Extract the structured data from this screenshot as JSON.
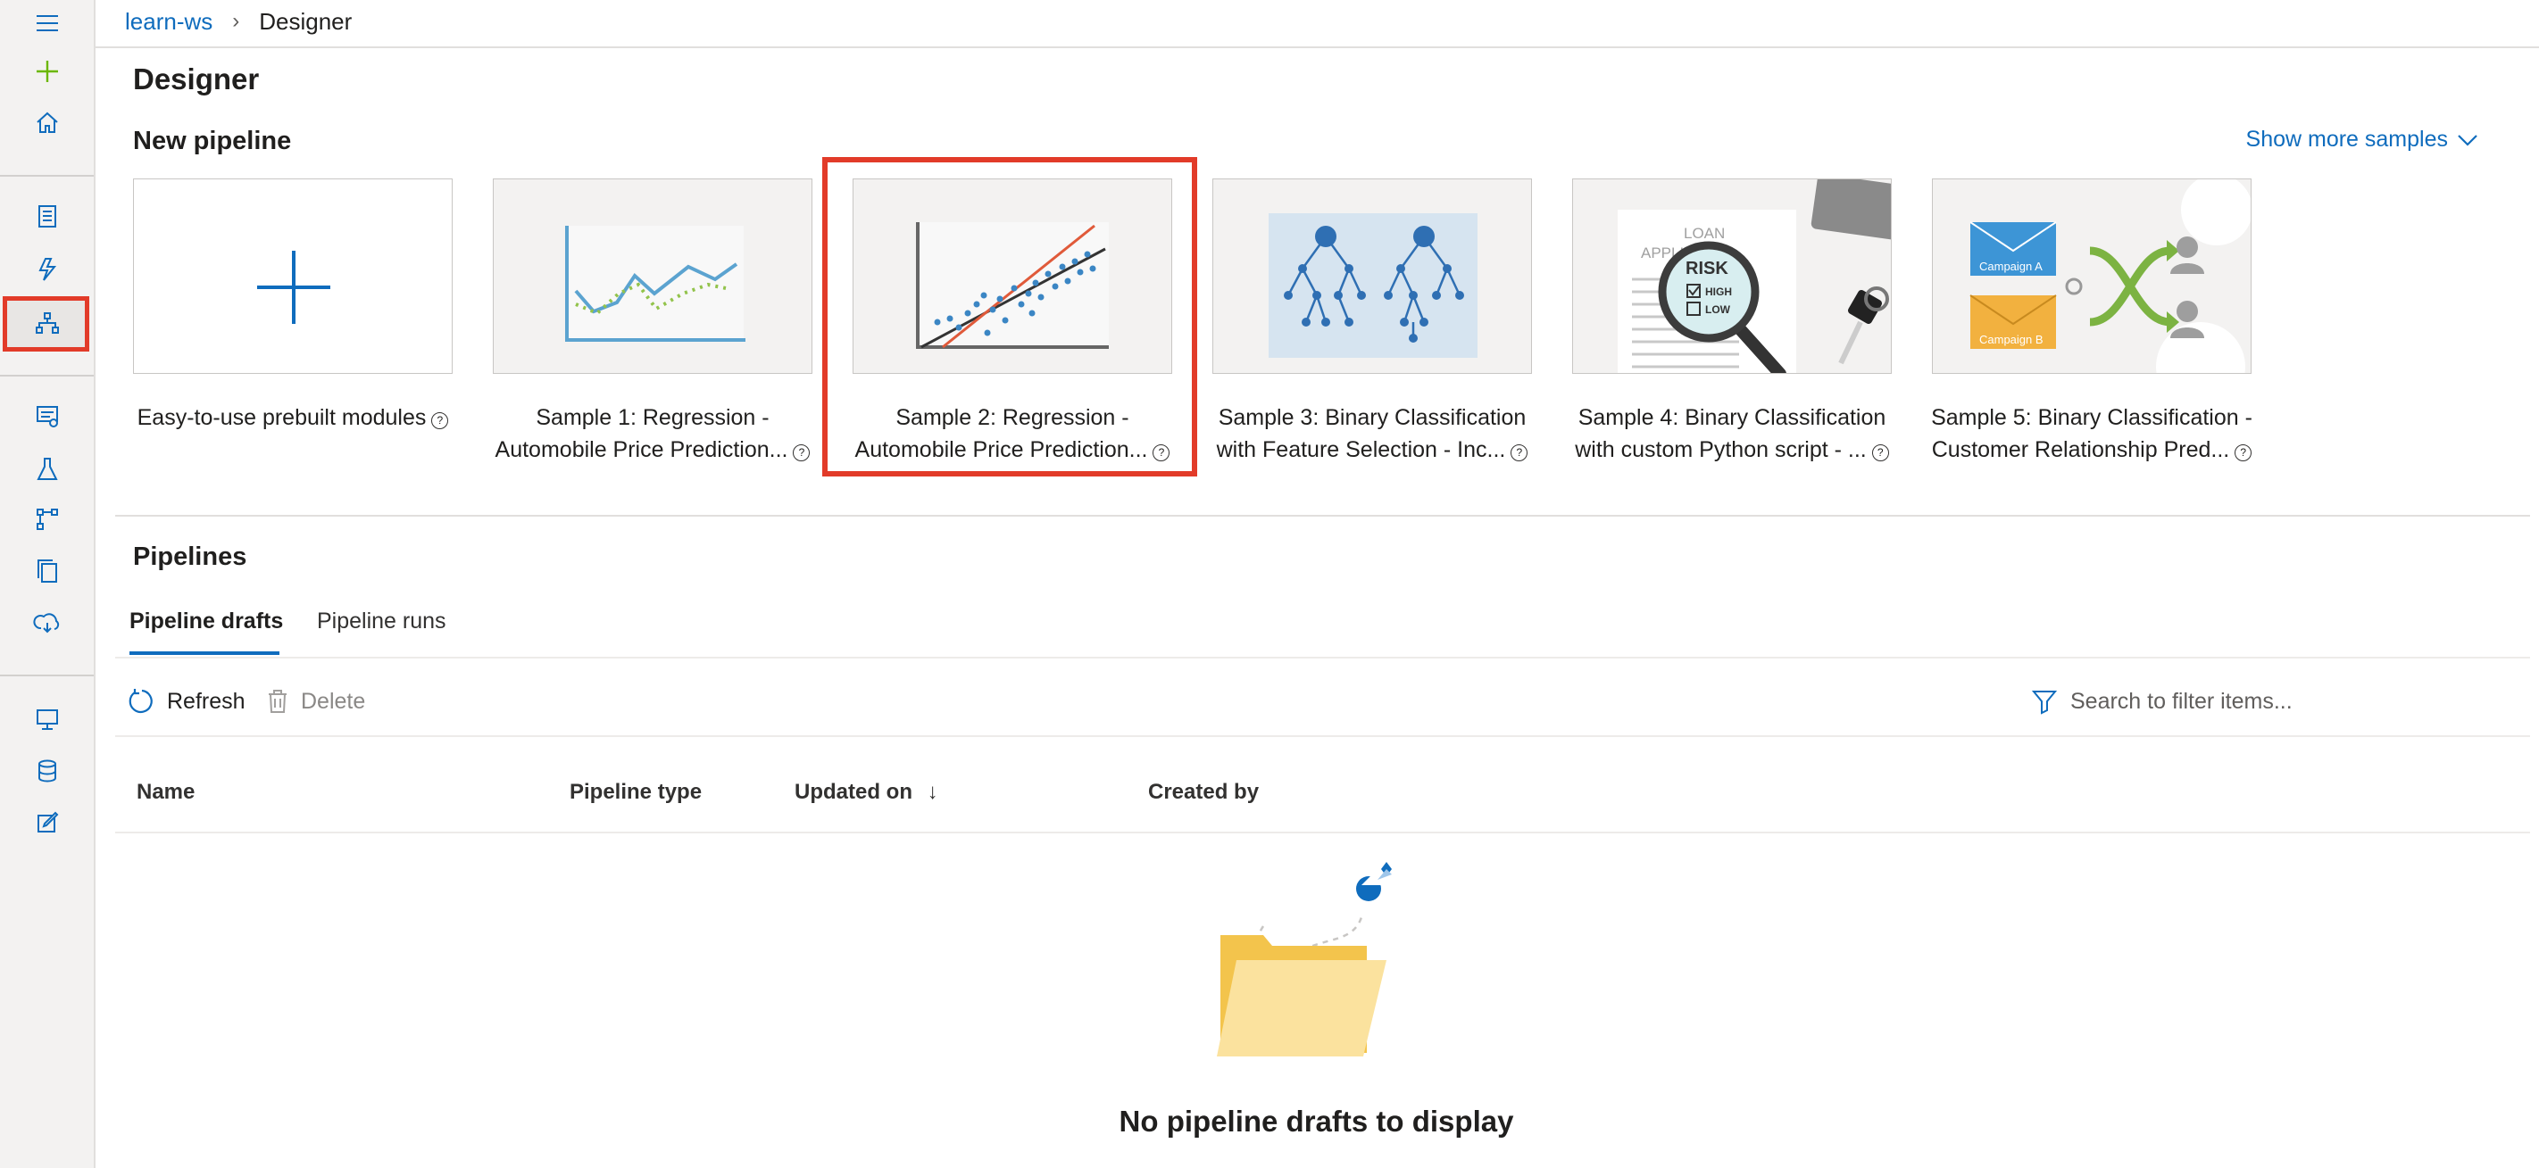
{
  "breadcrumb": {
    "workspace": "learn-ws",
    "separator": "›",
    "current": "Designer"
  },
  "page": {
    "title": "Designer"
  },
  "new_pipeline": {
    "title": "New pipeline",
    "show_more": "Show more samples",
    "cards": [
      {
        "line1": "Easy-to-use prebuilt modules",
        "line2": ""
      },
      {
        "line1": "Sample 1: Regression -",
        "line2": "Automobile Price Prediction..."
      },
      {
        "line1": "Sample 2: Regression -",
        "line2": "Automobile Price Prediction..."
      },
      {
        "line1": "Sample 3: Binary Classification",
        "line2": "with Feature Selection - Inc..."
      },
      {
        "line1": "Sample 4: Binary Classification",
        "line2": "with custom Python script - ..."
      },
      {
        "line1": "Sample 5: Binary Classification -",
        "line2": "Customer Relationship Pred..."
      }
    ],
    "art_text": {
      "loan": "LOAN",
      "appl": "APPLI",
      "risk": "RISK",
      "high": "HIGH",
      "low": "LOW",
      "campaign_a": "Campaign A",
      "campaign_b": "Campaign B"
    }
  },
  "pipelines": {
    "title": "Pipelines",
    "tabs": [
      "Pipeline drafts",
      "Pipeline runs"
    ],
    "active_tab": "Pipeline drafts",
    "toolbar": {
      "refresh": "Refresh",
      "delete": "Delete"
    },
    "search_placeholder": "Search to filter items...",
    "columns": [
      "Name",
      "Pipeline type",
      "Updated on",
      "Created by"
    ],
    "sort_indicator": "↓",
    "empty_message": "No pipeline drafts to display"
  },
  "colors": {
    "accent": "#0f6cbd",
    "highlight": "#e23b29",
    "icon_green": "#6bb700"
  }
}
